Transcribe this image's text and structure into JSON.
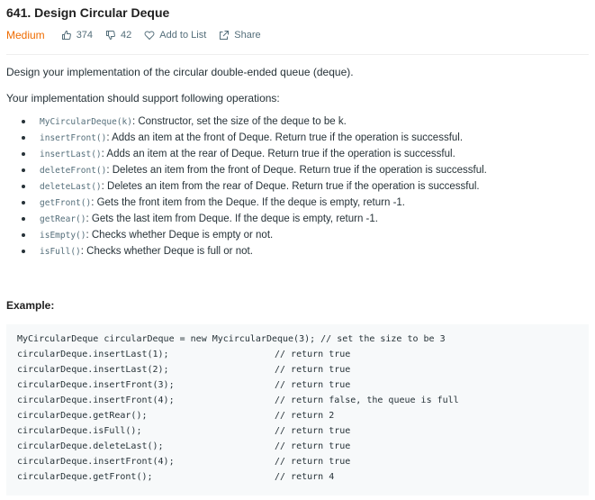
{
  "problem": {
    "title": "641. Design Circular Deque",
    "difficulty": "Medium",
    "likes": "374",
    "dislikes": "42",
    "add_to_list": "Add to List",
    "share": "Share"
  },
  "content": {
    "intro": "Design your implementation of the circular double-ended queue (deque).",
    "support": "Your implementation should support following operations:",
    "operations": [
      {
        "code": "MyCircularDeque(k)",
        "text": ": Constructor, set the size of the deque to be k."
      },
      {
        "code": "insertFront()",
        "text": ": Adds an item at the front of Deque. Return true if the operation is successful."
      },
      {
        "code": "insertLast()",
        "text": ": Adds an item at the rear of Deque. Return true if the operation is successful."
      },
      {
        "code": "deleteFront()",
        "text": ": Deletes an item from the front of Deque. Return true if the operation is successful."
      },
      {
        "code": "deleteLast()",
        "text": ": Deletes an item from the rear of Deque. Return true if the operation is successful."
      },
      {
        "code": "getFront()",
        "text": ": Gets the front item from the Deque. If the deque is empty, return -1."
      },
      {
        "code": "getRear()",
        "text": ": Gets the last item from Deque. If the deque is empty, return -1."
      },
      {
        "code": "isEmpty()",
        "text": ": Checks whether Deque is empty or not."
      },
      {
        "code": "isFull()",
        "text": ": Checks whether Deque is full or not."
      }
    ],
    "example_label": "Example:",
    "code_lines": [
      {
        "code": "MyCircularDeque circularDeque = new MycircularDeque(3); // set the size to be 3",
        "comment": ""
      },
      {
        "code": "circularDeque.insertLast(1);",
        "comment": "// return true"
      },
      {
        "code": "circularDeque.insertLast(2);",
        "comment": "// return true"
      },
      {
        "code": "circularDeque.insertFront(3);",
        "comment": "// return true"
      },
      {
        "code": "circularDeque.insertFront(4);",
        "comment": "// return false, the queue is full"
      },
      {
        "code": "circularDeque.getRear();",
        "comment": "// return 2"
      },
      {
        "code": "circularDeque.isFull();",
        "comment": "// return true"
      },
      {
        "code": "circularDeque.deleteLast();",
        "comment": "// return true"
      },
      {
        "code": "circularDeque.insertFront(4);",
        "comment": "// return true"
      },
      {
        "code": "circularDeque.getFront();",
        "comment": "// return 4"
      }
    ]
  },
  "colors": {
    "difficulty": "#ef6c00",
    "meta": "#546e7a",
    "code_bg": "#f7f9fa"
  }
}
